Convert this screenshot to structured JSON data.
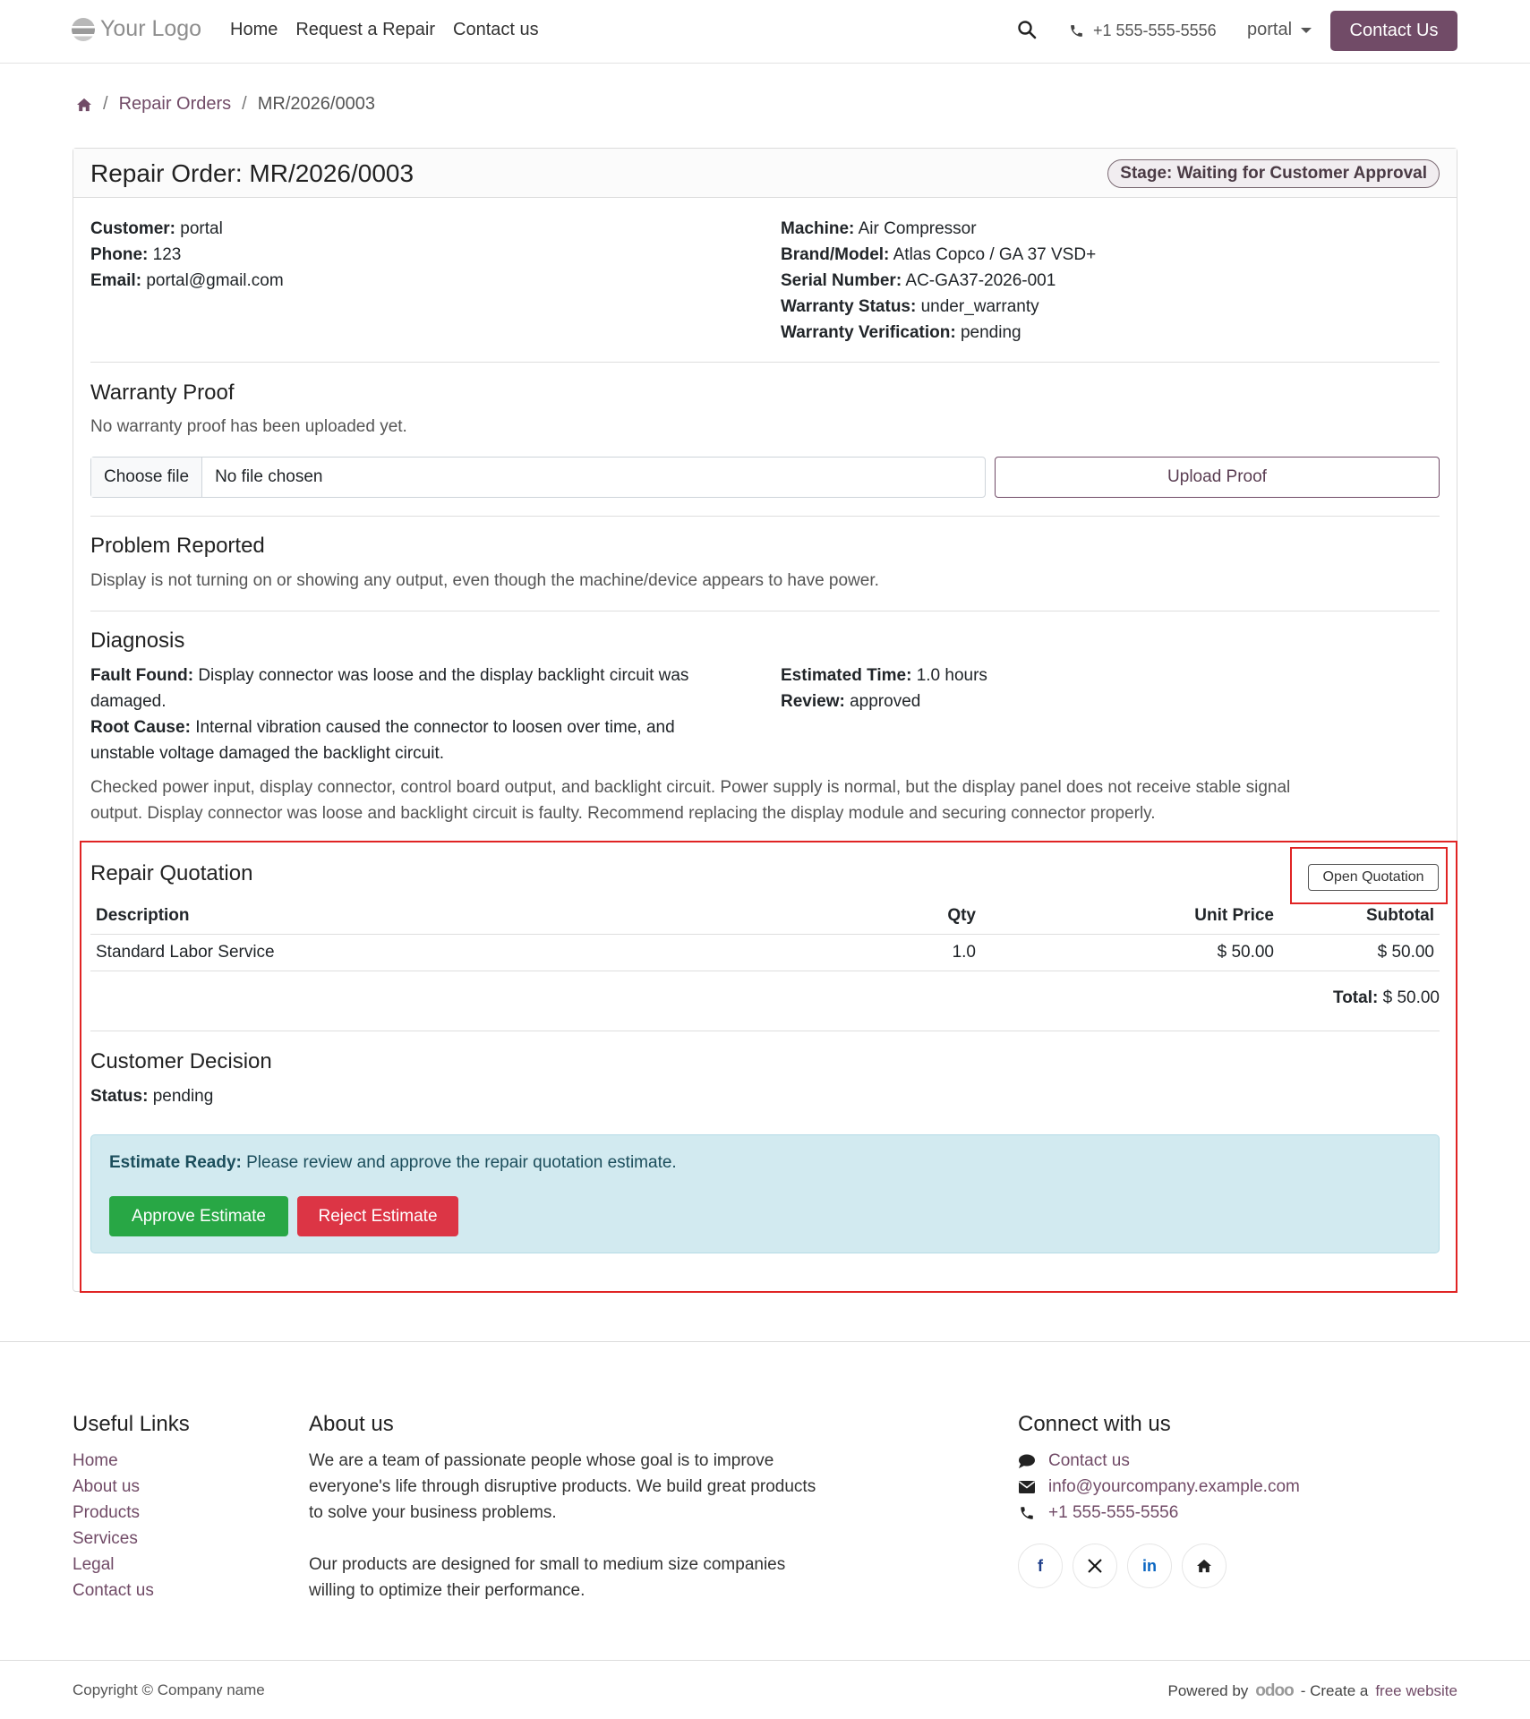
{
  "header": {
    "logo": "Your Logo",
    "nav": [
      "Home",
      "Request a Repair",
      "Contact us"
    ],
    "phone": "+1 555-555-5556",
    "user": "portal",
    "contact_button": "Contact Us"
  },
  "breadcrumb": {
    "link": "Repair Orders",
    "current": "MR/2026/0003"
  },
  "order": {
    "title": "Repair Order: MR/2026/0003",
    "stage": "Stage: Waiting for Customer Approval",
    "customer_label": "Customer:",
    "customer": "portal",
    "phone_label": "Phone:",
    "phone": "123",
    "email_label": "Email:",
    "email": "portal@gmail.com",
    "machine_label": "Machine:",
    "machine": "Air Compressor",
    "brand_label": "Brand/Model:",
    "brand": "Atlas Copco / GA 37 VSD+",
    "serial_label": "Serial Number:",
    "serial": "AC-GA37-2026-001",
    "warranty_status_label": "Warranty Status:",
    "warranty_status": "under_warranty",
    "warranty_verif_label": "Warranty Verification:",
    "warranty_verif": "pending"
  },
  "warranty": {
    "title": "Warranty Proof",
    "note": "No warranty proof has been uploaded yet.",
    "choose_file": "Choose file",
    "no_file": "No file chosen",
    "upload": "Upload Proof"
  },
  "problem": {
    "title": "Problem Reported",
    "text": "Display is not turning on or showing any output, even though the machine/device appears to have power."
  },
  "diagnosis": {
    "title": "Diagnosis",
    "fault_label": "Fault Found:",
    "fault_l1": "Display connector was loose and the display backlight circuit was",
    "fault_l2": "damaged.",
    "root_label": "Root Cause:",
    "root_l1": "Internal vibration caused the connector to loosen over time, and",
    "root_l2": "unstable voltage damaged the backlight circuit.",
    "time_label": "Estimated Time:",
    "time": "1.0 hours",
    "review_label": "Review:",
    "review": "approved",
    "notes_l1": "Checked power input, display connector, control board output, and backlight circuit. Power supply is normal, but the display panel does not receive stable signal",
    "notes_l2": "output. Display connector was loose and backlight circuit is faulty. Recommend replacing the display module and securing connector properly."
  },
  "quotation": {
    "title": "Repair Quotation",
    "open_button": "Open Quotation",
    "columns": [
      "Description",
      "Qty",
      "Unit Price",
      "Subtotal"
    ],
    "rows": [
      {
        "description": "Standard Labor Service",
        "qty": "1.0",
        "unit_price": "$ 50.00",
        "subtotal": "$ 50.00"
      }
    ],
    "total_label": "Total:",
    "total": "$ 50.00"
  },
  "decision": {
    "title": "Customer Decision",
    "status_label": "Status:",
    "status": "pending",
    "alert_bold": "Estimate Ready:",
    "alert_text": "Please review and approve the repair quotation estimate.",
    "approve": "Approve Estimate",
    "reject": "Reject Estimate"
  },
  "footer": {
    "useful_title": "Useful Links",
    "links": [
      "Home",
      "About us",
      "Products",
      "Services",
      "Legal",
      "Contact us"
    ],
    "about_title": "About us",
    "about_l1": "We are a team of passionate people whose goal is to improve",
    "about_l2": "everyone's life through disruptive products. We build great products",
    "about_l3": "to solve your business problems.",
    "about_l4": "Our products are designed for small to medium size companies",
    "about_l5": "willing to optimize their performance.",
    "connect_title": "Connect with us",
    "connect_contact": "Contact us",
    "connect_email": "info@yourcompany.example.com",
    "connect_phone": "+1 555-555-5556",
    "copyright": "Copyright © Company name",
    "powered_by": "Powered by",
    "odoo": "odoo",
    "create_a": "- Create a",
    "free_website": "free website"
  },
  "colors": {
    "brand": "#714B67",
    "approve": "#28a745",
    "reject": "#dc3545",
    "alert_bg": "#d2eaf0",
    "highlight": "#e02424"
  },
  "icons": {
    "search": "search-icon",
    "phone": "phone-icon",
    "home": "home-icon",
    "comment": "comment-icon",
    "envelope": "envelope-icon",
    "facebook": "facebook-icon",
    "x": "x-icon",
    "linkedin": "linkedin-icon"
  }
}
